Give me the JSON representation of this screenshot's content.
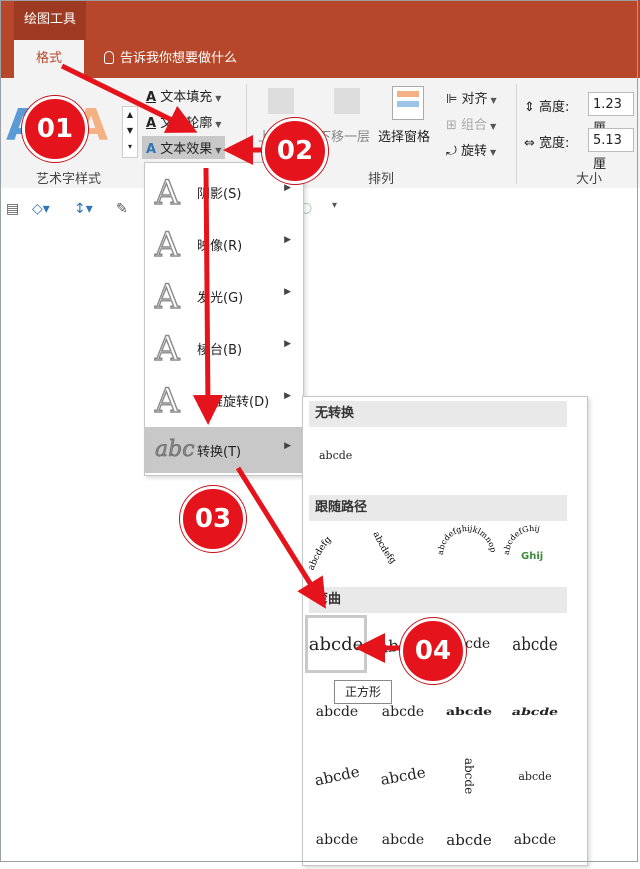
{
  "titlebar": {
    "context_tab": "绘图工具"
  },
  "tabs": {
    "format": "格式",
    "tellme": "告诉我你想要做什么"
  },
  "ribbon": {
    "wordart": {
      "group_label": "艺术字样式",
      "fill": "文本填充",
      "outline": "文本轮廓",
      "effects": "文本效果"
    },
    "arrange": {
      "group_label": "排列",
      "bring_forward": "上",
      "send_backward": "下移一层",
      "selection_pane": "选择窗格",
      "align": "对齐",
      "group": "组合",
      "rotate": "旋转"
    },
    "size": {
      "group_label": "大小",
      "height_label": "高度:",
      "height_value": "1.23 厘",
      "width_label": "宽度:",
      "width_value": "5.13 厘"
    }
  },
  "effects_menu": {
    "items": [
      {
        "label": "阴影(S)",
        "icon": "A"
      },
      {
        "label": "映像(R)",
        "icon": "A"
      },
      {
        "label": "发光(G)",
        "icon": "A"
      },
      {
        "label": "棱台(B)",
        "icon": "A"
      },
      {
        "label": "三维旋转(D)",
        "icon": "A"
      },
      {
        "label": "转换(T)",
        "icon": "abc"
      }
    ]
  },
  "transform_gallery": {
    "sections": [
      "无转换",
      "跟随路径",
      "弯曲"
    ],
    "no_transform_sample": "abcde",
    "warp_samples": [
      "abcde",
      "abcde",
      "abcde",
      "abcde",
      "abcde",
      "abcde",
      "abcde",
      "abcde",
      "abcde",
      "abcde",
      "abcde",
      "abcde",
      "abcde",
      "abcde",
      "abcde",
      "abcde"
    ],
    "path_samples": [
      "abcdefg",
      "abcdefg",
      "abcdefghijklmnop",
      "abcdefGhij"
    ],
    "path_center_text": "Ghij",
    "tooltip": "正方形"
  },
  "annotations": {
    "step1": "01",
    "step2": "02",
    "step3": "03",
    "step4": "04"
  },
  "colors": {
    "accent": "#b7472a",
    "badge": "#e5131b",
    "arrow": "#e5131b"
  }
}
